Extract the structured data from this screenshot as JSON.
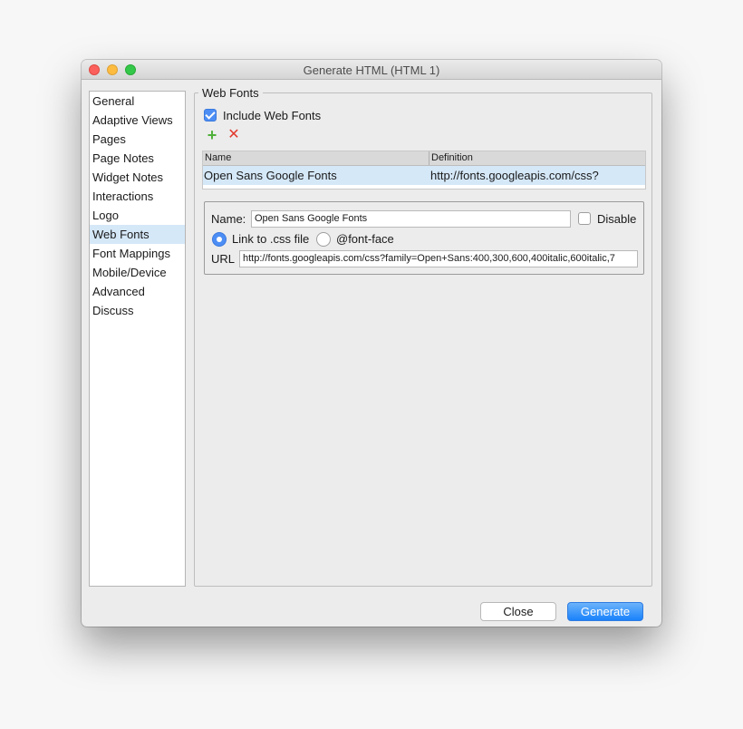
{
  "window": {
    "title": "Generate HTML (HTML 1)"
  },
  "sidebar": {
    "items": [
      {
        "label": "General"
      },
      {
        "label": "Adaptive Views"
      },
      {
        "label": "Pages"
      },
      {
        "label": "Page Notes"
      },
      {
        "label": "Widget Notes"
      },
      {
        "label": "Interactions"
      },
      {
        "label": "Logo"
      },
      {
        "label": "Web Fonts"
      },
      {
        "label": "Font Mappings"
      },
      {
        "label": "Mobile/Device"
      },
      {
        "label": "Advanced"
      },
      {
        "label": "Discuss"
      }
    ],
    "selected": "Web Fonts"
  },
  "web_fonts": {
    "group_title": "Web Fonts",
    "include_label": "Include Web Fonts",
    "include_checked": true,
    "add_icon": "plus-icon",
    "remove_icon": "x-icon",
    "add_symbol": "+",
    "remove_symbol": "✕",
    "table": {
      "columns": [
        "Name",
        "Definition"
      ],
      "rows": [
        {
          "name": "Open Sans Google Fonts",
          "definition": "http://fonts.googleapis.com/css?"
        }
      ]
    },
    "details": {
      "name_label": "Name:",
      "name_value": "Open Sans Google Fonts",
      "disable_label": "Disable",
      "disable_checked": false,
      "link_option_label": "Link to .css file",
      "fontface_option_label": "@font-face",
      "selected_option": "Link to .css file",
      "url_label": "URL",
      "url_value": "http://fonts.googleapis.com/css?family=Open+Sans:400,300,600,400italic,600italic,7"
    }
  },
  "buttons": {
    "close_label": "Close",
    "generate_label": "Generate"
  },
  "colors": {
    "accent": "#4d8ef5",
    "selection": "#d5e8f8",
    "add": "#4fb03a",
    "remove": "#e23a2e"
  }
}
